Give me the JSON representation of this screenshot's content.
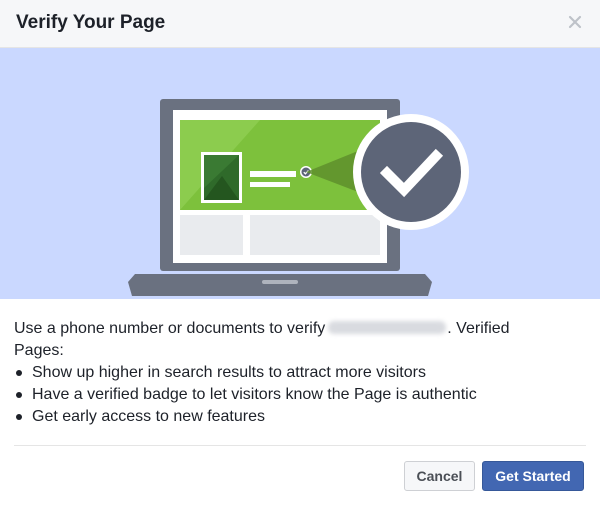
{
  "dialog": {
    "title": "Verify Your Page",
    "close_icon": "close-icon"
  },
  "hero": {
    "illustration": "laptop-verified-page-illustration",
    "badge_icon": "checkmark-icon",
    "colors": {
      "background": "#cad8ff",
      "laptop": "#6a7180",
      "cover": "#7dc13c",
      "badge": "#5d6578"
    }
  },
  "body": {
    "intro_before": "Use a phone number or documents to verify",
    "intro_after": ". Verified",
    "intro_line2": "Pages:",
    "features": [
      "Show up higher in search results to attract more visitors",
      "Have a verified badge to let visitors know the Page is authentic",
      "Get early access to new features"
    ]
  },
  "footer": {
    "cancel_label": "Cancel",
    "primary_label": "Get Started",
    "primary_color": "#4267b2"
  }
}
